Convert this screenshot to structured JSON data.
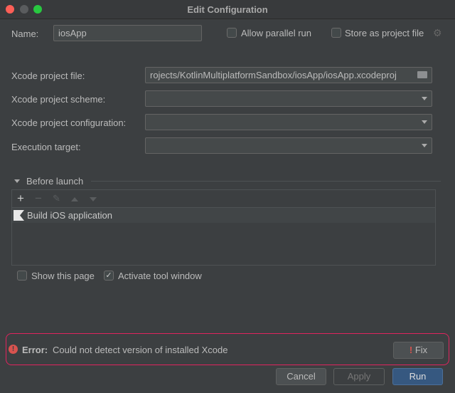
{
  "window": {
    "title": "Edit Configuration"
  },
  "name": {
    "label": "Name:",
    "value": "iosApp"
  },
  "options": {
    "allow_parallel": "Allow parallel run",
    "store_project": "Store as project file"
  },
  "fields": [
    {
      "label": "Xcode project file:",
      "value": "rojects/KotlinMultiplatformSandbox/iosApp/iosApp.xcodeproj"
    },
    {
      "label": "Xcode project scheme:",
      "value": ""
    },
    {
      "label": "Xcode project configuration:",
      "value": ""
    },
    {
      "label": "Execution target:",
      "value": ""
    }
  ],
  "before_launch": {
    "title": "Before launch",
    "tasks": [
      "Build iOS application"
    ],
    "show_page": "Show this page",
    "activate_tool": "Activate tool window"
  },
  "error": {
    "prefix": "Error:",
    "message": "Could not detect version of installed Xcode",
    "fix": "Fix",
    "color": "#e0245e"
  },
  "buttons": {
    "cancel": "Cancel",
    "apply": "Apply",
    "run": "Run"
  }
}
